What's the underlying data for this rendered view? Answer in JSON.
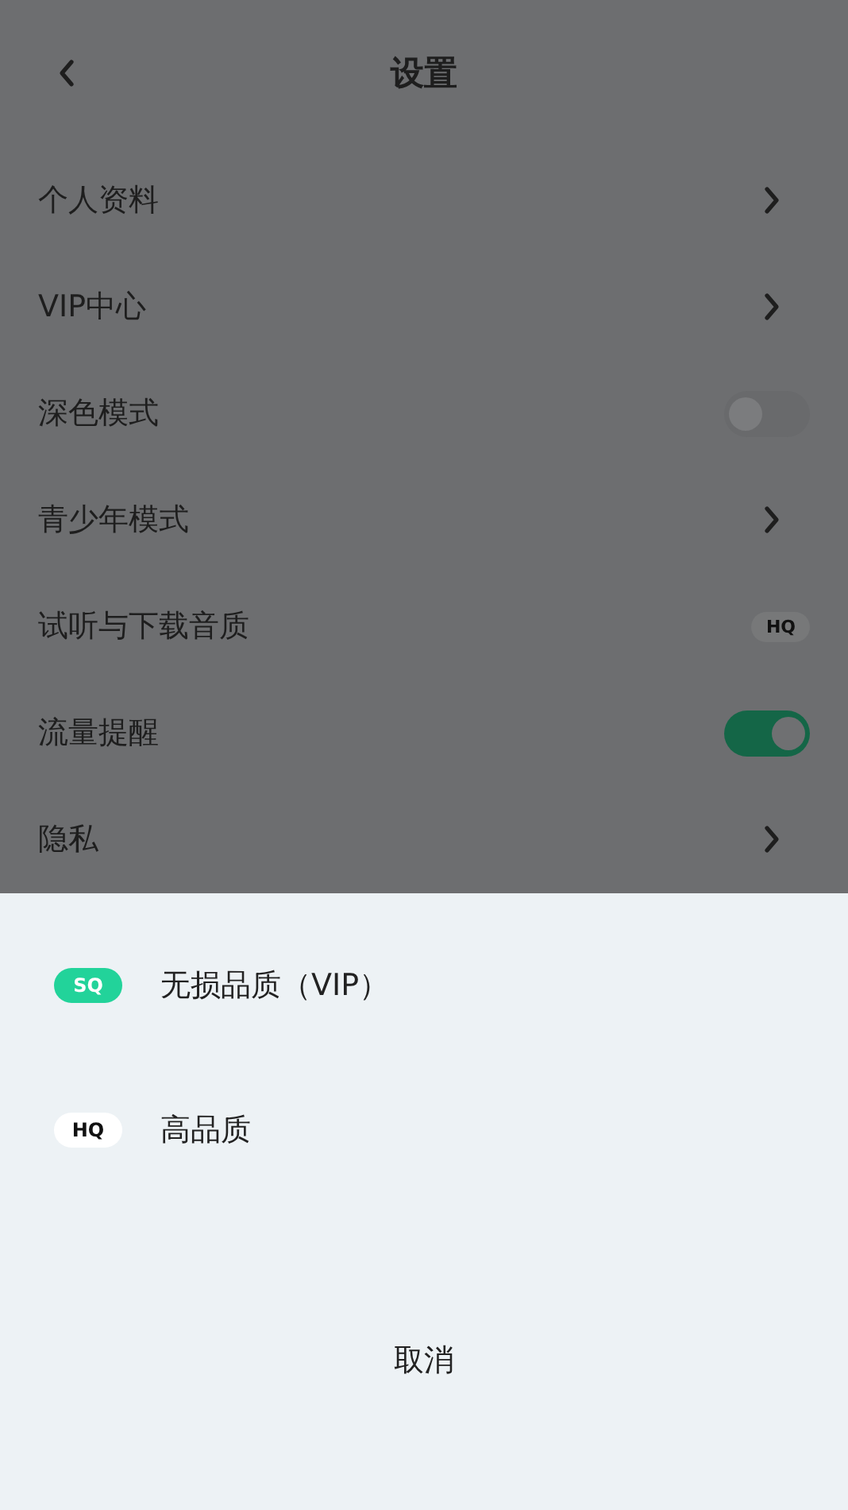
{
  "header": {
    "title": "设置"
  },
  "settings": [
    {
      "label": "个人资料",
      "kind": "link"
    },
    {
      "label": "VIP中心",
      "kind": "link"
    },
    {
      "label": "深色模式",
      "kind": "toggle",
      "on": false
    },
    {
      "label": "青少年模式",
      "kind": "link"
    },
    {
      "label": "试听与下载音质",
      "kind": "badge",
      "badge": "HQ"
    },
    {
      "label": "流量提醒",
      "kind": "toggle",
      "on": true
    },
    {
      "label": "隐私",
      "kind": "link"
    }
  ],
  "sheet": {
    "options": [
      {
        "badge": "SQ",
        "color": "#22d39a",
        "label": "无损品质（VIP）"
      },
      {
        "badge": "HQ",
        "color": "#ffffff",
        "label": "高品质"
      }
    ],
    "cancel": "取消"
  }
}
